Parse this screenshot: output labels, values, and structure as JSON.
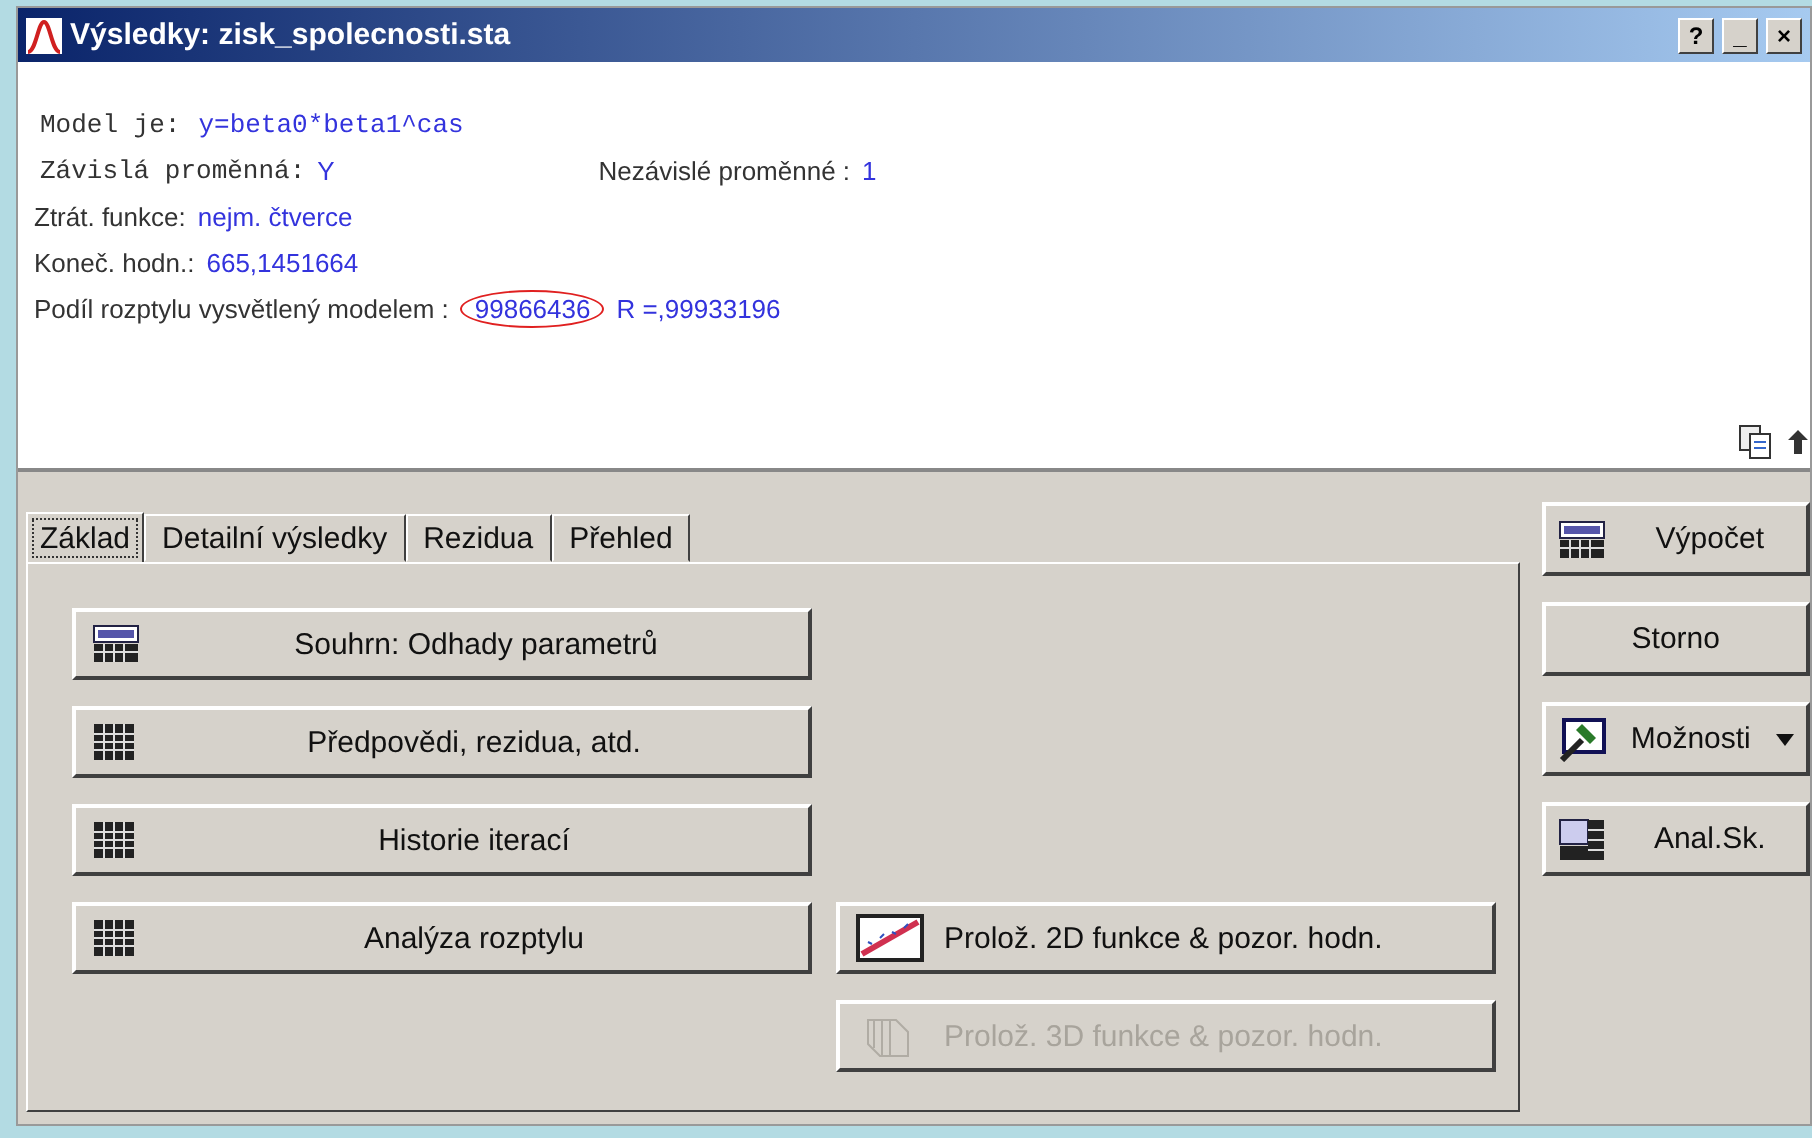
{
  "window": {
    "title": "Výsledky: zisk_spolecnosti.sta",
    "controls": [
      "?",
      "_",
      "×"
    ]
  },
  "results": {
    "lines": [
      {
        "items": [
          {
            "kind": "term",
            "text": "Model je:"
          },
          {
            "kind": "expression",
            "text": "y=beta0*beta1^cas"
          }
        ]
      },
      {
        "items": [
          {
            "kind": "term",
            "text": "Závislá proměnná:"
          },
          {
            "kind": "value",
            "text": "Y"
          },
          {
            "kind": "label",
            "text": "Nezávislé proměnné :"
          },
          {
            "kind": "value",
            "text": "1"
          }
        ]
      },
      {
        "items": [
          {
            "kind": "label",
            "text": "Ztrát. funkce:"
          },
          {
            "kind": "value",
            "text": "nejm. čtverce"
          }
        ]
      },
      {
        "items": [
          {
            "kind": "label",
            "text": "Koneč. hodn.:"
          },
          {
            "kind": "value",
            "text": "665,1451664"
          }
        ]
      },
      {
        "items": [
          {
            "kind": "label",
            "text": "Podíl rozptylu vysvětlený modelem :"
          },
          {
            "kind": "value",
            "text": "99866436",
            "circled": true
          },
          {
            "kind": "value",
            "text": "R =,99933196"
          }
        ]
      }
    ]
  },
  "tabs": [
    {
      "label": "Základ",
      "selected": true
    },
    {
      "label": "Detailní výsledky",
      "selected": false
    },
    {
      "label": "Rezidua",
      "selected": false
    },
    {
      "label": "Přehled",
      "selected": false
    }
  ],
  "left_buttons": [
    {
      "label": "Souhrn: Odhady parametrů"
    },
    {
      "label": "Předpovědi, rezidua, atd."
    },
    {
      "label": "Historie iterací"
    },
    {
      "label": "Analýza rozptylu"
    }
  ],
  "fit_buttons": [
    {
      "label": "Prolož. 2D funkce & pozor. hodn.",
      "disabled": false
    },
    {
      "label": "Prolož. 3D funkce & pozor. hodn.",
      "disabled": true
    }
  ],
  "side_buttons": [
    {
      "label": "Výpočet",
      "dropdown": false
    },
    {
      "label": "Storno",
      "dropdown": false
    },
    {
      "label": "Možnosti",
      "dropdown": true
    },
    {
      "label": "Anal.Sk.",
      "dropdown": false
    }
  ]
}
